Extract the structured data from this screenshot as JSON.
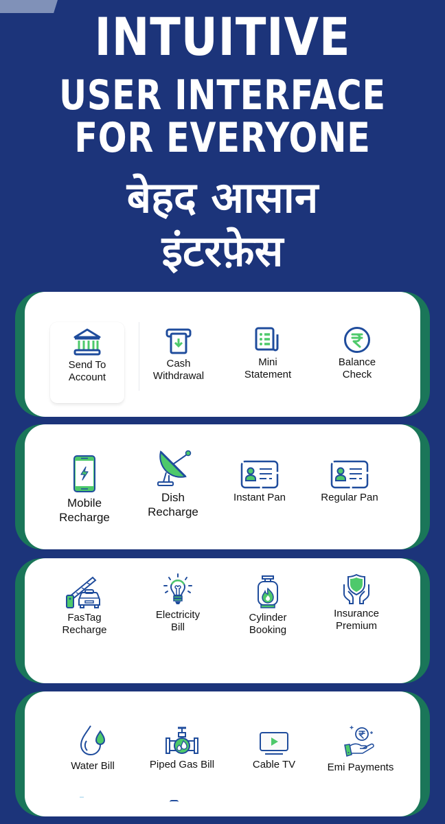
{
  "header": {
    "line1": "INTUITIVE",
    "line2": "USER INTERFACE",
    "line3": "FOR EVERYONE",
    "hindi_line1": "बेहद आसान",
    "hindi_line2": "इंटरफ़ेस"
  },
  "colors": {
    "background": "#1c347a",
    "card_backing": "#1a7659",
    "icon_stroke": "#1f4c9c",
    "icon_accent": "#4ec96b"
  },
  "sections": [
    {
      "tiles": [
        {
          "id": "send-to-account",
          "icon": "bank-icon",
          "label": [
            "Send To",
            "Account"
          ],
          "selected": true
        },
        {
          "id": "cash-withdrawal",
          "icon": "atm-icon",
          "label": [
            "Cash",
            "Withdrawal"
          ]
        },
        {
          "id": "mini-statement",
          "icon": "statement-icon",
          "label": [
            "Mini",
            "Statement"
          ]
        },
        {
          "id": "balance-check",
          "icon": "rupee-icon",
          "label": [
            "Balance",
            "Check"
          ]
        }
      ]
    },
    {
      "tiles": [
        {
          "id": "mobile-recharge",
          "icon": "mobile-icon",
          "label": [
            "Mobile",
            "Recharge"
          ]
        },
        {
          "id": "dish-recharge",
          "icon": "satellite-dish-icon",
          "label": [
            "Dish",
            "Recharge"
          ]
        },
        {
          "id": "instant-pan",
          "icon": "id-card-icon",
          "label": [
            "Instant Pan"
          ]
        },
        {
          "id": "regular-pan",
          "icon": "id-card-icon",
          "label": [
            "Regular Pan"
          ]
        }
      ]
    },
    {
      "tiles": [
        {
          "id": "fastag-recharge",
          "icon": "toll-gate-car-icon",
          "label": [
            "FasTag",
            "Recharge"
          ]
        },
        {
          "id": "electricity-bill",
          "icon": "light-bulb-icon",
          "label": [
            "Electricity",
            "Bill"
          ]
        },
        {
          "id": "cylinder-booking",
          "icon": "gas-cylinder-icon",
          "label": [
            "Cylinder",
            "Booking"
          ]
        },
        {
          "id": "insurance-premium",
          "icon": "shield-hands-icon",
          "label": [
            "Insurance",
            "Premium"
          ]
        }
      ]
    },
    {
      "tiles": [
        {
          "id": "water-bill",
          "icon": "water-drop-icon",
          "label": [
            "Water Bill"
          ]
        },
        {
          "id": "piped-gas-bill",
          "icon": "gas-pipe-icon",
          "label": [
            "Piped Gas Bill"
          ]
        },
        {
          "id": "cable-tv",
          "icon": "tv-play-icon",
          "label": [
            "Cable TV"
          ]
        },
        {
          "id": "emi-payments",
          "icon": "hand-rupee-icon",
          "label": [
            "Emi Payments"
          ]
        }
      ]
    }
  ]
}
